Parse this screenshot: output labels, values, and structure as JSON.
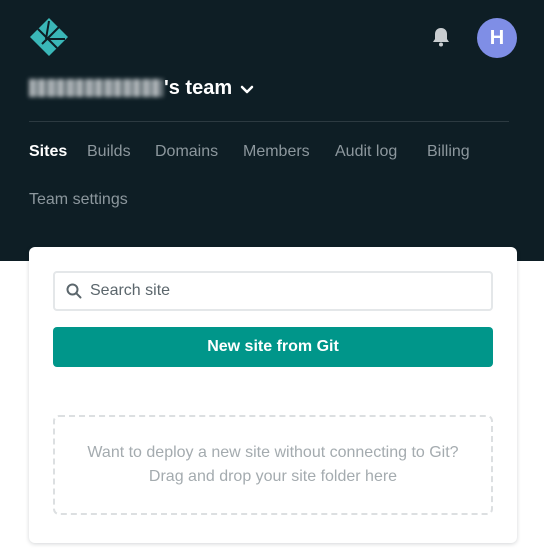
{
  "header": {
    "team_name_suffix": "'s team",
    "avatar_initial": "H"
  },
  "tabs": [
    {
      "label": "Sites",
      "active": true
    },
    {
      "label": "Builds",
      "active": false
    },
    {
      "label": "Domains",
      "active": false
    },
    {
      "label": "Members",
      "active": false
    },
    {
      "label": "Audit log",
      "active": false
    },
    {
      "label": "Billing",
      "active": false
    },
    {
      "label": "Team settings",
      "active": false
    }
  ],
  "sites": {
    "search_placeholder": "Search site",
    "search_value": "",
    "new_site_button": "New site from Git",
    "dropzone": {
      "line1": "Want to deploy a new site without connecting to Git?",
      "line2": "Drag and drop your site folder here"
    }
  },
  "colors": {
    "header_bg": "#0e1e25",
    "accent_teal": "#00968a",
    "avatar_bg": "#7f8ee6",
    "logo": "#3ab7b8"
  },
  "icons": [
    "netlify-logo",
    "bell-icon",
    "chevron-down-icon",
    "search-icon"
  ]
}
